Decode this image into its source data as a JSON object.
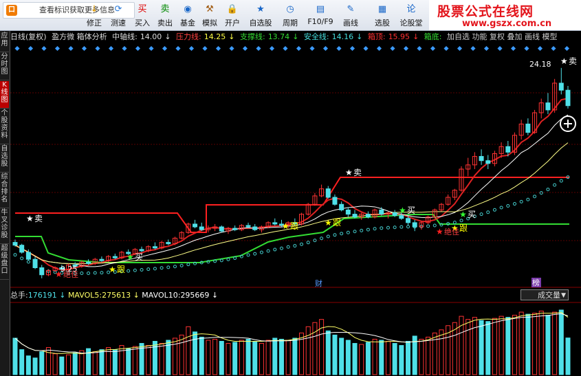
{
  "tip": {
    "icon": "口",
    "text": "查看标识获取更多信息"
  },
  "toolbar": [
    {
      "name": "modify-button",
      "label": "修正",
      "glyph": "↓",
      "color": "#e8a000"
    },
    {
      "name": "test-speed-button",
      "label": "测速",
      "glyph": "⟳",
      "color": "#2a7ad8"
    },
    {
      "name": "buy-button",
      "label": "买入",
      "glyph": "买",
      "color": "#d00"
    },
    {
      "name": "sell-button",
      "label": "卖出",
      "glyph": "卖",
      "color": "#080"
    },
    {
      "name": "fund-button",
      "label": "基金",
      "glyph": "◉",
      "color": "#1866c8"
    },
    {
      "name": "simulate-button",
      "label": "模拟",
      "glyph": "⚒",
      "color": "#a05a10"
    },
    {
      "name": "open-account-button",
      "label": "开户",
      "glyph": "🔒",
      "color": "#c08020"
    },
    {
      "name": "watchlist-button",
      "label": "自选股",
      "glyph": "★",
      "color": "#1866c8"
    },
    {
      "name": "period-button",
      "label": "周期",
      "glyph": "◷",
      "color": "#1866c8"
    },
    {
      "name": "f10-button",
      "label": "F10/F9",
      "glyph": "▤",
      "color": "#1866c8"
    },
    {
      "name": "draw-button",
      "label": "画线",
      "glyph": "✎",
      "color": "#1866c8"
    },
    {
      "name": "pick-stock-button",
      "label": "选股",
      "glyph": "▦",
      "color": "#1866c8"
    },
    {
      "name": "forum-button",
      "label": "论股堂",
      "glyph": "论",
      "color": "#1866c8"
    }
  ],
  "logo": {
    "title": "股票公式在线网",
    "url": "www.gszx.com.cn"
  },
  "sidebar": [
    "应用",
    "分时图",
    "K线图",
    "个股资料",
    "自选股",
    "综合排名",
    "牛叉诊股",
    "超级盘口"
  ],
  "info": {
    "period": "日线(复权)",
    "indicator": "盈方微 箱体分析",
    "mid_label": "中轴线:",
    "mid_val": "14.00",
    "press_label": "压力线:",
    "press_val": "14.25",
    "support_label": "支撑线:",
    "support_val": "13.74",
    "safe_label": "安全线:",
    "safe_val": "14.16",
    "top_label": "箱顶:",
    "top_val": "15.95",
    "bottom_label": "箱底:",
    "extra": "加自选  功能  复权  叠加  画线  模型"
  },
  "annotations": {
    "high": "24.18",
    "low": "9.25",
    "sell": "卖",
    "buy": "买",
    "follow": "跟",
    "bottom": "绝佳",
    "cai": "财",
    "bang": "榜"
  },
  "vol": {
    "total_label": "总手:",
    "total": "176191",
    "m5_label": "MAVOL5:",
    "m5": "275613",
    "m10_label": "MAVOL10:",
    "m10": "295669"
  },
  "volume_selector": "成交量",
  "colors": {
    "up": "#ff3333",
    "down": "#4fe0e8",
    "resist": "#ff2020",
    "support": "#33dd33",
    "ma_white": "#ffffff",
    "ma_yellow": "#ffff66",
    "ma_cyan": "#44cccc"
  },
  "chart_data": {
    "type": "candlestick",
    "ohlc": [
      [
        11.8,
        12.0,
        11.5,
        11.6
      ],
      [
        11.6,
        11.7,
        11.0,
        11.1
      ],
      [
        11.1,
        11.3,
        10.5,
        10.6
      ],
      [
        10.6,
        10.8,
        9.9,
        10.0
      ],
      [
        10.0,
        10.2,
        9.25,
        9.5
      ],
      [
        9.5,
        9.9,
        9.4,
        9.8
      ],
      [
        9.8,
        10.1,
        9.7,
        10.0
      ],
      [
        10.0,
        10.2,
        9.8,
        9.9
      ],
      [
        9.9,
        10.3,
        9.8,
        10.2
      ],
      [
        10.2,
        10.4,
        10.0,
        10.1
      ],
      [
        10.1,
        10.5,
        10.0,
        10.4
      ],
      [
        10.4,
        10.6,
        10.2,
        10.3
      ],
      [
        10.3,
        10.7,
        10.2,
        10.6
      ],
      [
        10.6,
        10.8,
        10.4,
        10.5
      ],
      [
        10.5,
        10.9,
        10.4,
        10.8
      ],
      [
        10.8,
        11.0,
        10.6,
        10.7
      ],
      [
        10.7,
        11.2,
        10.6,
        11.1
      ],
      [
        11.1,
        11.3,
        10.9,
        11.0
      ],
      [
        11.0,
        11.4,
        10.9,
        11.3
      ],
      [
        11.3,
        11.5,
        11.1,
        11.2
      ],
      [
        11.2,
        11.6,
        11.1,
        11.5
      ],
      [
        11.5,
        11.8,
        11.3,
        11.4
      ],
      [
        11.4,
        11.9,
        11.3,
        11.8
      ],
      [
        11.8,
        12.0,
        11.6,
        11.7
      ],
      [
        11.7,
        12.2,
        11.6,
        12.1
      ],
      [
        12.1,
        12.6,
        12.0,
        12.5
      ],
      [
        12.5,
        13.2,
        12.4,
        13.1
      ],
      [
        13.1,
        13.4,
        12.8,
        12.9
      ],
      [
        12.9,
        13.2,
        12.6,
        12.7
      ],
      [
        12.7,
        13.0,
        12.5,
        12.8
      ],
      [
        12.8,
        13.1,
        12.6,
        12.9
      ],
      [
        12.9,
        13.0,
        12.5,
        12.6
      ],
      [
        12.6,
        12.9,
        12.4,
        12.8
      ],
      [
        12.8,
        13.0,
        12.6,
        12.7
      ],
      [
        12.7,
        13.1,
        12.6,
        13.0
      ],
      [
        13.0,
        13.2,
        12.8,
        12.9
      ],
      [
        12.9,
        13.1,
        12.6,
        12.7
      ],
      [
        12.7,
        13.0,
        12.5,
        12.9
      ],
      [
        12.9,
        13.3,
        12.8,
        13.2
      ],
      [
        13.2,
        13.5,
        13.0,
        13.1
      ],
      [
        13.1,
        13.4,
        12.9,
        13.0
      ],
      [
        13.0,
        13.3,
        12.8,
        13.2
      ],
      [
        13.2,
        13.5,
        13.0,
        13.1
      ],
      [
        13.1,
        13.9,
        13.0,
        13.8
      ],
      [
        13.8,
        14.6,
        13.7,
        14.5
      ],
      [
        14.5,
        15.3,
        14.4,
        15.1
      ],
      [
        15.1,
        15.9,
        15.0,
        15.6
      ],
      [
        15.6,
        15.8,
        14.9,
        15.0
      ],
      [
        15.0,
        15.2,
        14.4,
        14.5
      ],
      [
        14.5,
        14.7,
        14.0,
        14.1
      ],
      [
        14.1,
        14.3,
        13.6,
        13.8
      ],
      [
        13.8,
        14.1,
        13.5,
        13.6
      ],
      [
        13.6,
        13.9,
        13.4,
        13.8
      ],
      [
        13.8,
        14.0,
        13.5,
        13.6
      ],
      [
        13.6,
        14.2,
        13.5,
        14.1
      ],
      [
        14.1,
        14.3,
        13.7,
        13.8
      ],
      [
        13.8,
        14.0,
        13.5,
        13.9
      ],
      [
        13.9,
        14.1,
        13.6,
        13.7
      ],
      [
        13.7,
        13.9,
        13.4,
        13.5
      ],
      [
        13.5,
        13.7,
        13.0,
        13.2
      ],
      [
        13.2,
        13.4,
        12.6,
        12.9
      ],
      [
        12.9,
        13.3,
        12.7,
        13.2
      ],
      [
        13.2,
        13.7,
        13.1,
        13.6
      ],
      [
        13.6,
        14.2,
        13.5,
        14.1
      ],
      [
        14.1,
        14.6,
        14.0,
        14.5
      ],
      [
        14.5,
        15.2,
        14.4,
        15.0
      ],
      [
        15.0,
        15.6,
        14.8,
        15.5
      ],
      [
        15.5,
        17.2,
        15.4,
        17.0
      ],
      [
        17.0,
        17.8,
        16.5,
        17.3
      ],
      [
        17.3,
        18.2,
        17.0,
        17.9
      ],
      [
        17.9,
        18.4,
        17.3,
        17.6
      ],
      [
        17.6,
        18.0,
        17.0,
        17.4
      ],
      [
        17.4,
        18.3,
        17.2,
        18.1
      ],
      [
        18.1,
        18.9,
        17.8,
        18.6
      ],
      [
        18.6,
        19.0,
        17.9,
        18.2
      ],
      [
        18.2,
        19.6,
        18.0,
        19.4
      ],
      [
        19.4,
        20.5,
        19.1,
        20.2
      ],
      [
        20.2,
        20.6,
        19.4,
        19.6
      ],
      [
        19.6,
        21.2,
        19.5,
        21.0
      ],
      [
        21.0,
        22.0,
        20.6,
        21.7
      ],
      [
        21.7,
        22.4,
        20.9,
        21.2
      ],
      [
        21.2,
        23.4,
        21.0,
        23.1
      ],
      [
        23.1,
        24.18,
        22.3,
        22.6
      ],
      [
        22.6,
        22.9,
        21.3,
        21.5
      ]
    ],
    "volume": [
      175,
      120,
      90,
      80,
      110,
      130,
      100,
      85,
      95,
      105,
      115,
      125,
      110,
      120,
      130,
      120,
      140,
      125,
      135,
      150,
      140,
      160,
      150,
      165,
      175,
      190,
      230,
      205,
      180,
      165,
      170,
      160,
      150,
      155,
      165,
      170,
      160,
      150,
      165,
      175,
      170,
      165,
      175,
      200,
      230,
      250,
      265,
      210,
      190,
      175,
      165,
      150,
      145,
      155,
      170,
      165,
      160,
      150,
      140,
      160,
      185,
      170,
      180,
      200,
      215,
      235,
      250,
      280,
      265,
      275,
      260,
      255,
      270,
      280,
      275,
      285,
      300,
      290,
      295,
      305,
      285,
      300,
      310,
      176
    ],
    "price_axis": [
      9,
      25
    ],
    "volume_axis": [
      0,
      320
    ],
    "resist_line": "箱顶",
    "support_line": "支撑"
  }
}
